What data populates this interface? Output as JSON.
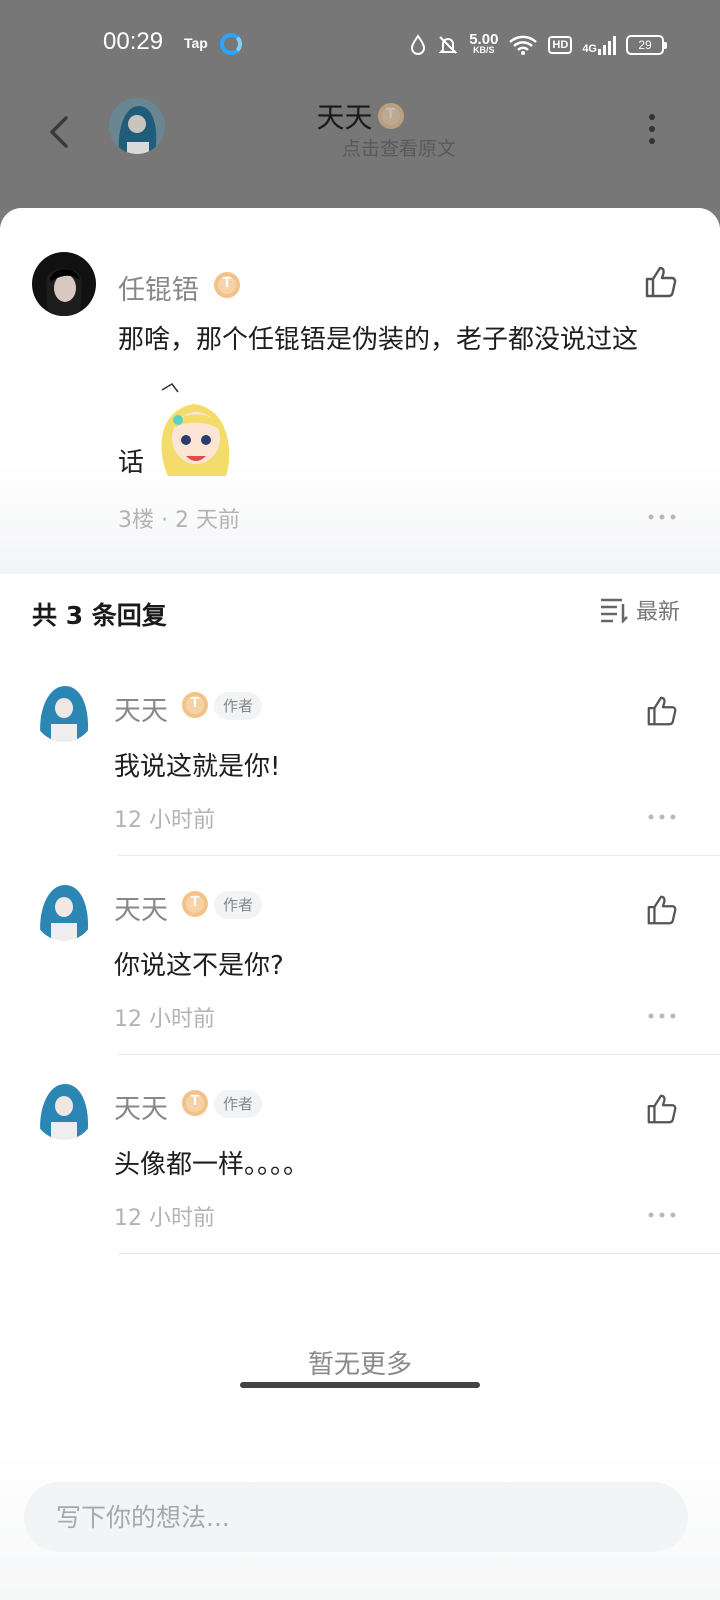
{
  "status_bar": {
    "time": "00:29",
    "app_label": "Tap",
    "net_speed_value": "5.00",
    "net_speed_unit": "KB/S",
    "hd": "HD",
    "signal_type": "4G",
    "battery": "29"
  },
  "header": {
    "title": "天天",
    "badge_letter": "T",
    "subtitle": "点击查看原文"
  },
  "main_comment": {
    "author": "任锟铻",
    "badge_letter": "T",
    "text_line1": "那啥，那个任锟铻是伪装的，老子都没说过这",
    "text_line2": "话",
    "meta": "3楼 · 2 天前"
  },
  "replies_header": {
    "title": "共 3 条回复",
    "sort_label": "最新"
  },
  "replies": [
    {
      "author": "天天",
      "badge_letter": "T",
      "tag": "作者",
      "text": "我说这就是你!",
      "time": "12 小时前"
    },
    {
      "author": "天天",
      "badge_letter": "T",
      "tag": "作者",
      "text": "你说这不是你?",
      "time": "12 小时前"
    },
    {
      "author": "天天",
      "badge_letter": "T",
      "tag": "作者",
      "text": "头像都一样。。。。",
      "time": "12 小时前"
    }
  ],
  "footer": {
    "no_more": "暂无更多",
    "input_placeholder": "写下你的想法..."
  },
  "colors": {
    "overlay": "#777777",
    "badge": "#f2c28a",
    "text_secondary": "#888888",
    "text_meta": "#b3b3b3"
  }
}
